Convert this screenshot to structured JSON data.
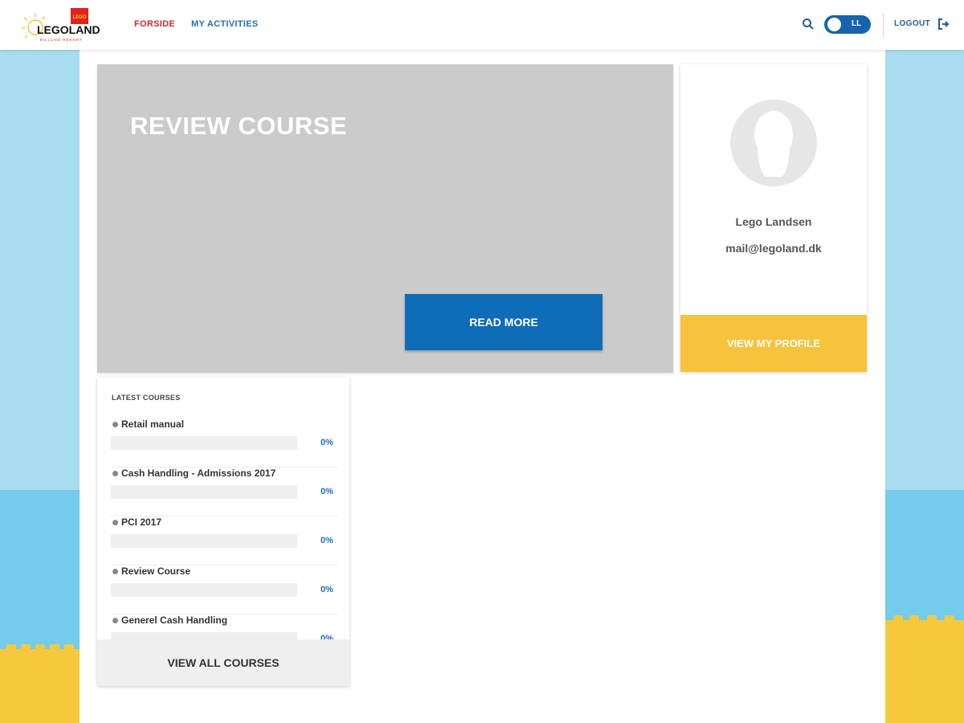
{
  "brand": {
    "name": "LEGOLAND",
    "tagline": "BILLUND RESORT",
    "lego_badge": "LEGO"
  },
  "nav": {
    "items": [
      {
        "label": "FORSIDE"
      },
      {
        "label": "MY ACTIVITIES"
      }
    ]
  },
  "user_toggle": {
    "initials": "LL"
  },
  "logout": {
    "label": "LOGOUT"
  },
  "hero": {
    "title": "REVIEW COURSE",
    "button_label": "READ MORE"
  },
  "profile": {
    "name": "Lego Landsen",
    "email": "mail@legoland.dk",
    "button_label": "VIEW MY PROFILE"
  },
  "courses": {
    "heading": "LATEST COURSES",
    "items": [
      {
        "name": "Retail manual",
        "progress": 0,
        "progress_label": "0%"
      },
      {
        "name": "Cash Handling - Admissions 2017",
        "progress": 0,
        "progress_label": "0%"
      },
      {
        "name": "PCI 2017",
        "progress": 0,
        "progress_label": "0%"
      },
      {
        "name": "Review Course",
        "progress": 0,
        "progress_label": "0%"
      },
      {
        "name": "Generel Cash Handling",
        "progress": 0,
        "progress_label": "0%"
      }
    ],
    "view_all_label": "VIEW ALL COURSES"
  },
  "colors": {
    "brand_red": "#d0282e",
    "link_blue": "#1f6fb5",
    "primary_blue": "#0f6cb6",
    "accent_yellow": "#f7c23c",
    "hero_gray": "#cbcbcb"
  }
}
